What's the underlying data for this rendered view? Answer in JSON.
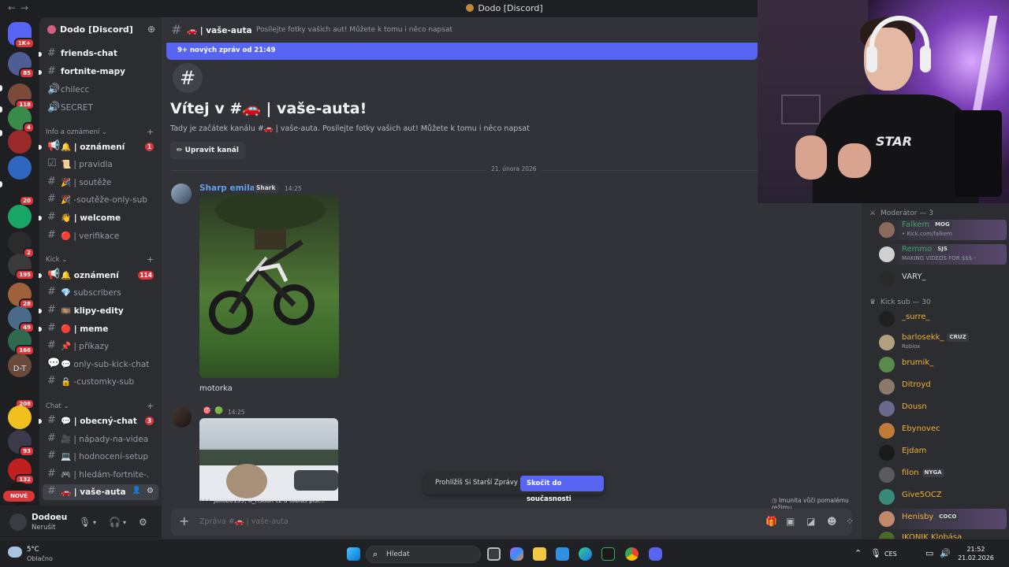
{
  "window": {
    "title": "Dodo [Discord]"
  },
  "rail": {
    "badges": [
      "1K+",
      "85",
      "118",
      "4",
      "",
      "",
      "20",
      "",
      "2",
      "195",
      "28",
      "49",
      "166",
      "",
      "208",
      "",
      "93",
      "132",
      ""
    ],
    "dt_label": "D-T",
    "new_label": "NOVÉ"
  },
  "server": {
    "name": "Dodo [Discord]"
  },
  "sidebar": {
    "channels_top": [
      {
        "name": "friends-chat"
      },
      {
        "name": "fortnite-mapy"
      },
      {
        "name": "chilecc"
      },
      {
        "name": "SECRET"
      }
    ],
    "categories": [
      "Info a oznámení",
      "Kick",
      "Chat"
    ],
    "info_channels": [
      {
        "name": "🔔 | oznámení",
        "badge": "1"
      },
      {
        "name": "📜 | pravidla",
        "badge": ""
      },
      {
        "name": "🎉 | soutěže",
        "badge": ""
      },
      {
        "name": "🎉 -soutěže-only-sub",
        "badge": ""
      },
      {
        "name": "👋 | welcome",
        "badge": ""
      },
      {
        "name": "🔴 | verifikace",
        "badge": ""
      }
    ],
    "kick_channels": [
      {
        "name": "🔔 oznámení",
        "badge": "114"
      },
      {
        "name": "💎 subscribers",
        "badge": ""
      },
      {
        "name": "🎞️ klipy-edity",
        "badge": ""
      },
      {
        "name": "🔴 | meme",
        "badge": ""
      },
      {
        "name": "📌 | příkazy",
        "badge": ""
      },
      {
        "name": "💬 only-sub-kick-chat",
        "badge": ""
      },
      {
        "name": "🔒 -customky-sub",
        "badge": ""
      }
    ],
    "chat_channels": [
      {
        "name": "💬 | obecný-chat",
        "badge": "3"
      },
      {
        "name": "🎥 | nápady-na-videa",
        "badge": ""
      },
      {
        "name": "💻 | hodnocení-setupů",
        "badge": ""
      },
      {
        "name": "🎮 | hledám-fortnite-...",
        "badge": ""
      },
      {
        "name": "🚗 | vaše-auta",
        "badge": ""
      }
    ]
  },
  "user": {
    "name": "Dodoeu",
    "status": "Nerušit"
  },
  "channel": {
    "name": "🚗 | vaše-auta",
    "topic": "Posílejte fotky vašich aut! Můžete k tomu i něco napsat",
    "new_messages": "9+ nových zpráv od 21:49",
    "welcome_title": "Vítej v #🚗 | vaše-auta!",
    "welcome_sub": "Tady je začátek kanálu #🚗 | vaše-auta. Posílejte fotky vašich aut! Můžete k tomu i něco napsat",
    "edit_label": "✏ Upravit kanál",
    "date_divider": "21. února 2026"
  },
  "messages": [
    {
      "author": "Sharp emilavr",
      "tag": "Shark",
      "time": "14:25",
      "caption": "motorka"
    },
    {
      "author": "",
      "time": "14:25"
    }
  ],
  "typing": "jakobo159, K_ristian cz a tobias píší...",
  "immunity": "Imunita vůči pomalému režimu",
  "older_bar": {
    "older": "Prohlížíš Si Starší Zprávy",
    "jump": "Skočit do současnosti"
  },
  "composer": {
    "placeholder": "Zpráva #🚗 | vaše-auta"
  },
  "members": {
    "moderator_header": "Moderátor — 3",
    "kick_header": "Kick sub — 30",
    "moderators": [
      {
        "name": "Falkem",
        "tag": "MOG",
        "status": "• Kick.com/falkem",
        "color": "#3ba55c"
      },
      {
        "name": "Remmo",
        "tag": "SJS",
        "status": "MAKING VIDEOS FOR $$$ -",
        "color": "#3ba55c"
      },
      {
        "name": "VARY_",
        "tag": "",
        "status": "",
        "color": "#dbdee1"
      }
    ],
    "kick": [
      {
        "name": "_surre_",
        "tag": "",
        "status": "",
        "color": "#f0b232"
      },
      {
        "name": "barlosekk_",
        "tag": "CRUZ",
        "status": "Roblox",
        "color": "#f0b232"
      },
      {
        "name": "brumik_",
        "tag": "",
        "status": "",
        "color": "#f0b232"
      },
      {
        "name": "Ditroyd",
        "tag": "",
        "status": "",
        "color": "#f0b232"
      },
      {
        "name": "Dousn",
        "tag": "",
        "status": "",
        "color": "#f0b232"
      },
      {
        "name": "Ebynovec",
        "tag": "",
        "status": "",
        "color": "#f0b232"
      },
      {
        "name": "Ejdam",
        "tag": "",
        "status": "",
        "color": "#f0b232"
      },
      {
        "name": "filon",
        "tag": "NYGA",
        "status": "",
        "color": "#f0b232"
      },
      {
        "name": "Give5OCZ",
        "tag": "",
        "status": "",
        "color": "#f0b232"
      },
      {
        "name": "Henisby",
        "tag": "COCO",
        "status": "",
        "color": "#f0b232"
      },
      {
        "name": "IKONIK Klobása",
        "tag": "",
        "status": "",
        "color": "#f0b232"
      }
    ]
  },
  "webcam": {
    "shirt_text": "STAR"
  },
  "taskbar": {
    "temp": "5°C",
    "weather": "Oblačno",
    "search_placeholder": "Hledat",
    "lang": "CES",
    "time": "21:52",
    "date": "21.02.2026"
  }
}
